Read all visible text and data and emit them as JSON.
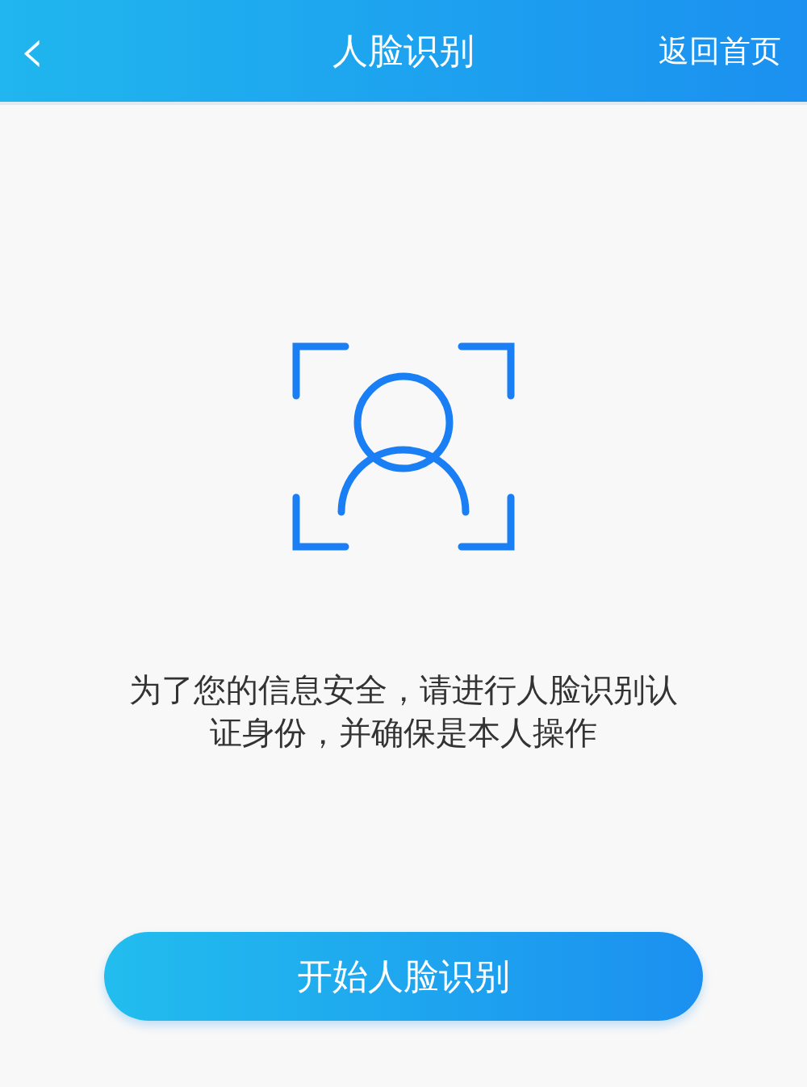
{
  "header": {
    "back": "‹",
    "title": "人脸识别",
    "home_link": "返回首页"
  },
  "message": "为了您的信息安全，请进行人脸识别认证身份，并确保是本人操作",
  "button": "开始人脸识别"
}
